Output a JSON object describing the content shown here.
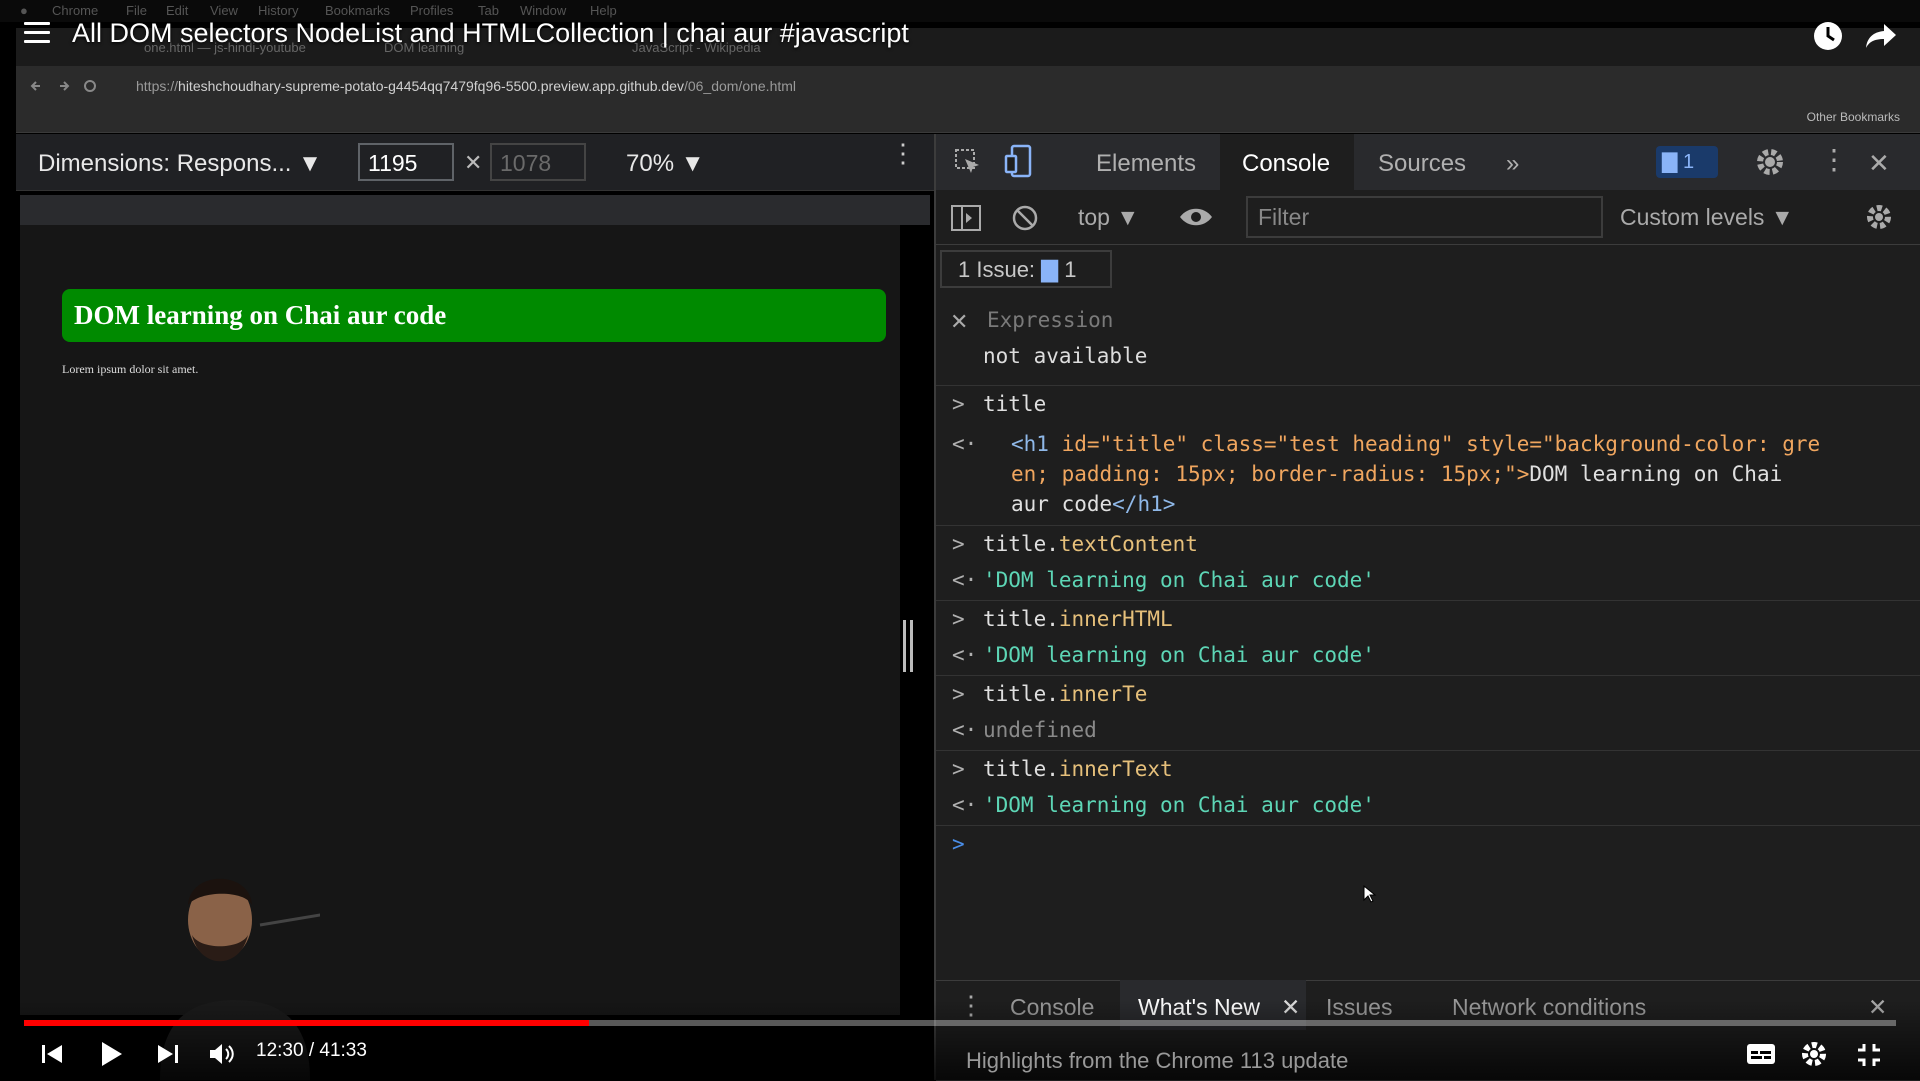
{
  "menubar": {
    "items": [
      "Chrome",
      "File",
      "Edit",
      "View",
      "History",
      "Bookmarks",
      "Profiles",
      "Tab",
      "Window",
      "Help"
    ]
  },
  "video": {
    "title": "All DOM selectors NodeList and HTMLCollection | chai aur #javascript",
    "time": "12:30 / 41:33",
    "progress_fraction": 0.302
  },
  "browser": {
    "tabs": [
      "one.html — js-hindi-youtube",
      "DOM learning",
      "JavaScript - Wikipedia"
    ],
    "url_prefix": "https://",
    "url_host": "hiteshchoudhary-supreme-potato-g4454qq7479fq96-5500.preview.app.github.dev",
    "url_path": "/06_dom/one.html",
    "bookmarks_label": "Other Bookmarks"
  },
  "device_toolbar": {
    "dimensions": "Dimensions: Respons...",
    "width": "1195",
    "height": "1078",
    "zoom": "70%"
  },
  "page": {
    "heading": "DOM learning on Chai aur code",
    "paragraph": "Lorem ipsum dolor sit amet."
  },
  "devtools": {
    "tabs": [
      "Elements",
      "Console",
      "Sources"
    ],
    "more": "»",
    "issues_badge": "1",
    "context": "top",
    "filter_placeholder": "Filter",
    "levels": "Custom levels",
    "issue_pill_label": "1 Issue:",
    "issue_pill_count": "1",
    "expression_label": "Expression",
    "expression_value": "not available",
    "console": [
      {
        "input": "title"
      },
      {
        "html_tag_open": "<h1 ",
        "attrs": "id=\"title\" class=\"test heading\" style=\"background-color: gre",
        "line2": "en; padding: 15px; border-radius: 15px;\">",
        "text2": "DOM learning on Chai",
        "line3_text": "aur code",
        "close": "</h1>"
      },
      {
        "obj": "title.",
        "prop": "textContent",
        "result": "'DOM learning on Chai aur code'"
      },
      {
        "obj": "title.",
        "prop": "innerHTML",
        "result": "'DOM learning on Chai aur code'"
      },
      {
        "obj": "title.",
        "prop": "innerTe",
        "result": "undefined"
      },
      {
        "obj": "title.",
        "prop": "innerText",
        "result": "'DOM learning on Chai aur code'"
      }
    ],
    "drawer": {
      "tabs": [
        "Console",
        "What's New",
        "Issues",
        "Network conditions"
      ],
      "highlight": "Highlights from the Chrome 113 update"
    }
  },
  "colors": {
    "heading_bg": "#008a00",
    "progress": "#ff0000",
    "badge": "#1a73e8"
  }
}
